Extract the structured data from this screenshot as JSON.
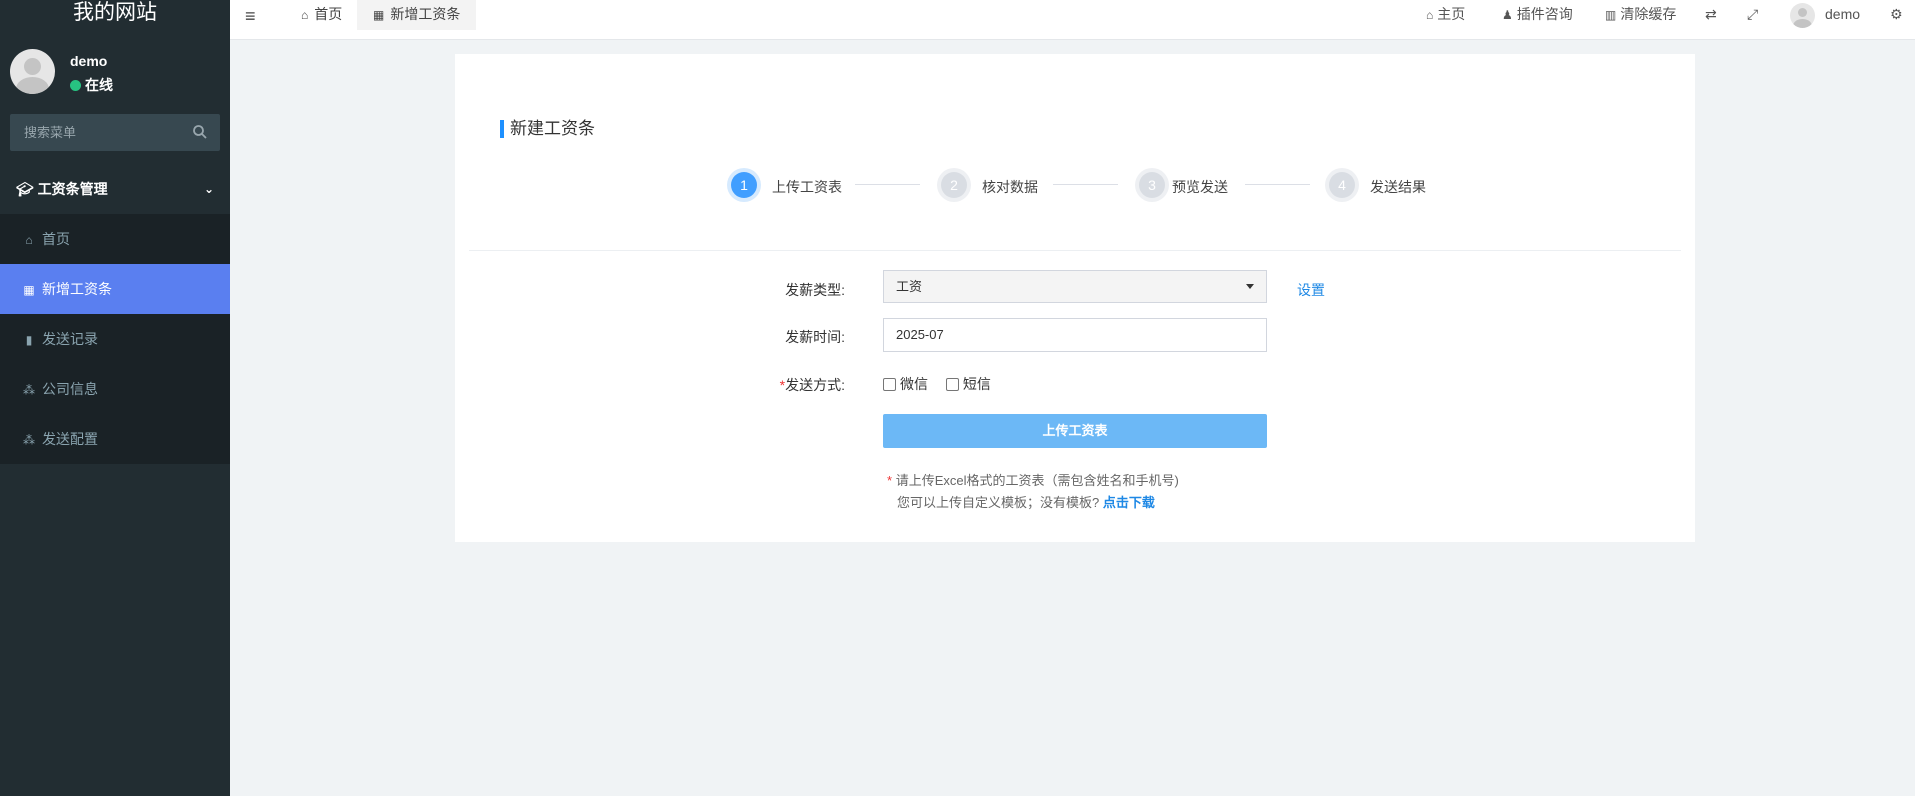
{
  "sidebar": {
    "brand": "我的网站",
    "user": {
      "name": "demo",
      "status": "在线"
    },
    "search": {
      "placeholder": "搜索菜单"
    },
    "group": {
      "label": "工资条管理"
    },
    "items": [
      {
        "label": "首页",
        "icon": "home-icon"
      },
      {
        "label": "新增工资条",
        "icon": "calendar-icon"
      },
      {
        "label": "发送记录",
        "icon": "file-icon"
      },
      {
        "label": "公司信息",
        "icon": "cubes-icon"
      },
      {
        "label": "发送配置",
        "icon": "cubes-icon"
      }
    ],
    "colors": {
      "bg": "#222d32",
      "active": "#5a7ff0"
    }
  },
  "topbar": {
    "tabs": [
      {
        "label": "首页",
        "icon": "home-icon"
      },
      {
        "label": "新增工资条",
        "icon": "calendar-icon"
      }
    ],
    "right": {
      "home": "主页",
      "plugin": "插件咨询",
      "clear_cache": "清除缓存",
      "user": "demo"
    }
  },
  "card": {
    "title": "新建工资条",
    "steps": [
      {
        "num": "1",
        "label": "上传工资表"
      },
      {
        "num": "2",
        "label": "核对数据"
      },
      {
        "num": "3",
        "label": "预览发送"
      },
      {
        "num": "4",
        "label": "发送结果"
      }
    ],
    "form": {
      "type_label": "发薪类型:",
      "type_value": "工资",
      "settings_link": "设置",
      "time_label": "发薪时间:",
      "time_value": "2025-07",
      "method_required": "*",
      "method_label": "发送方式:",
      "methods": [
        "微信",
        "短信"
      ],
      "upload_button": "上传工资表",
      "hint_star": "*",
      "hint_line1": "请上传Excel格式的工资表（需包含姓名和手机号)",
      "hint_line2": "您可以上传自定义模板；没有模板?",
      "download_link": "点击下载"
    },
    "colors": {
      "primary": "#409eff",
      "button": "#6cb8f6",
      "link": "#1e88e5"
    }
  }
}
